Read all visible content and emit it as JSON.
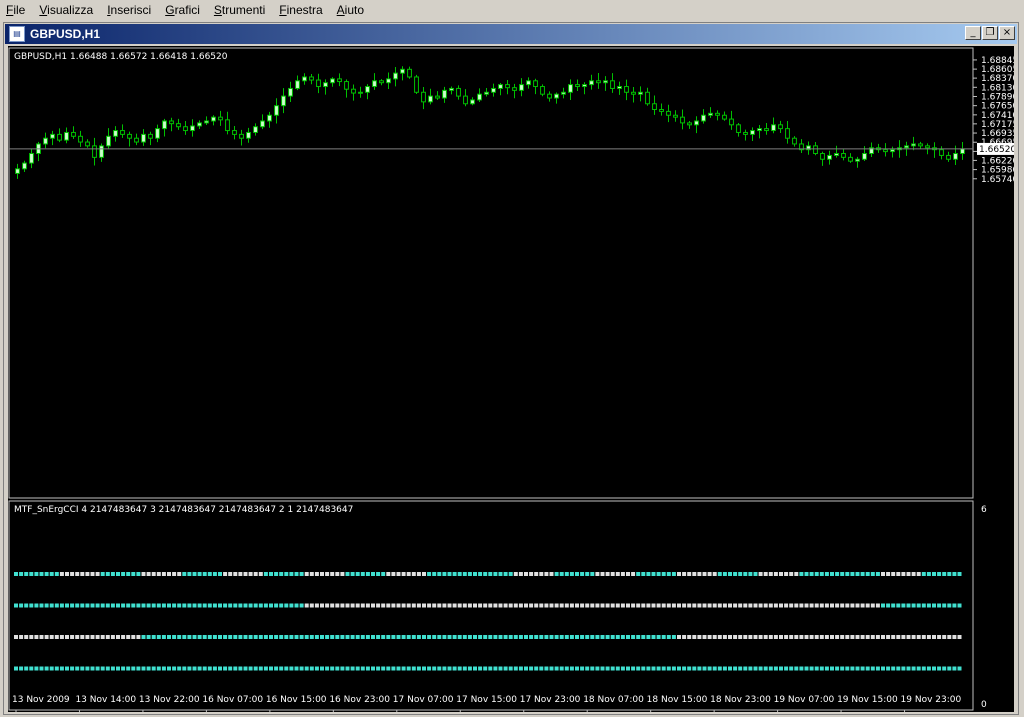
{
  "menu": [
    {
      "id": "file",
      "accel": "F",
      "rest": "ile"
    },
    {
      "id": "visualizza",
      "accel": "V",
      "rest": "isualizza"
    },
    {
      "id": "inserisci",
      "accel": "I",
      "rest": "nserisci"
    },
    {
      "id": "grafici",
      "accel": "G",
      "rest": "rafici"
    },
    {
      "id": "strumenti",
      "accel": "S",
      "rest": "trumenti"
    },
    {
      "id": "finestra",
      "accel": "F",
      "rest": "inestra"
    },
    {
      "id": "aiuto",
      "accel": "A",
      "rest": "iuto"
    }
  ],
  "window": {
    "title": "GBPUSD,H1",
    "icon": "chart-window-icon",
    "controls": [
      {
        "name": "minimize-button",
        "glyph": "_"
      },
      {
        "name": "restore-button",
        "glyph": "❐"
      },
      {
        "name": "close-button",
        "glyph": "×"
      }
    ]
  },
  "colors": {
    "bg": "#000000",
    "axis": "#c0c0c0",
    "candle_bull": "#ccffcc",
    "candle_bear": "#000000",
    "wick": "#00c000",
    "bid_line": "#808080",
    "dot_cyan": "#40e0d0",
    "dot_white": "#e0e0e0",
    "text": "#ffffff"
  },
  "chart_data": {
    "type": "candlestick",
    "symbol": "GBPUSD,H1",
    "ohlc_label": "1.66488 1.66572 1.66418 1.66520",
    "bid": "1.66520",
    "bid_value": 1.6652,
    "ylim": [
      1.574,
      1.69
    ],
    "yticks": [
      "1.68845",
      "1.68605",
      "1.68370",
      "1.68130",
      "1.67890",
      "1.67650",
      "1.67410",
      "1.67175",
      "1.66935",
      "1.66695",
      "1.66455",
      "1.66220",
      "1.65980",
      "1.65740"
    ],
    "xticks": [
      "13 Nov 2009",
      "13 Nov 14:00",
      "13 Nov 22:00",
      "16 Nov 07:00",
      "16 Nov 15:00",
      "16 Nov 23:00",
      "17 Nov 07:00",
      "17 Nov 15:00",
      "17 Nov 23:00",
      "18 Nov 07:00",
      "18 Nov 15:00",
      "18 Nov 23:00",
      "19 Nov 07:00",
      "19 Nov 15:00",
      "19 Nov 23:00"
    ],
    "closes": [
      1.66,
      1.6615,
      1.664,
      1.6665,
      1.668,
      1.669,
      1.6675,
      1.6695,
      1.6685,
      1.667,
      1.666,
      1.663,
      1.666,
      1.6685,
      1.67,
      1.669,
      1.668,
      1.667,
      1.669,
      1.668,
      1.6705,
      1.6725,
      1.6718,
      1.671,
      1.67,
      1.6712,
      1.672,
      1.6725,
      1.6735,
      1.6728,
      1.67,
      1.669,
      1.668,
      1.6695,
      1.671,
      1.6725,
      1.674,
      1.6765,
      1.679,
      1.681,
      1.683,
      1.684,
      1.6832,
      1.6815,
      1.6825,
      1.6835,
      1.6828,
      1.6808,
      1.6798,
      1.68,
      1.6815,
      1.683,
      1.6825,
      1.6835,
      1.685,
      1.686,
      1.684,
      1.68,
      1.6775,
      1.679,
      1.6785,
      1.6805,
      1.681,
      1.679,
      1.677,
      1.678,
      1.6795,
      1.68,
      1.681,
      1.682,
      1.6812,
      1.6805,
      1.682,
      1.683,
      1.6815,
      1.6795,
      1.6785,
      1.6795,
      1.68,
      1.682,
      1.6815,
      1.682,
      1.683,
      1.6825,
      1.683,
      1.681,
      1.6815,
      1.68,
      1.6795,
      1.68,
      1.677,
      1.6755,
      1.675,
      1.674,
      1.6735,
      1.672,
      1.6715,
      1.6725,
      1.674,
      1.6745,
      1.674,
      1.673,
      1.6715,
      1.6695,
      1.669,
      1.67,
      1.6705,
      1.67,
      1.6715,
      1.6705,
      1.668,
      1.6665,
      1.665,
      1.666,
      1.664,
      1.6625,
      1.6635,
      1.664,
      1.663,
      1.662,
      1.6625,
      1.664,
      1.6655,
      1.665,
      1.6645,
      1.665,
      1.6655,
      1.666,
      1.6665,
      1.666,
      1.6655,
      1.665,
      1.6635,
      1.6625,
      1.664,
      1.6652
    ],
    "indicator": {
      "label": "MTF_SnErgCCI 4 2147483647 3 2147483647 2147483647 2 1 2147483647",
      "scale_top": "6",
      "scale_bottom": "0",
      "rows": [
        {
          "level": 4,
          "pattern": "cwcwcwcwcwccwcwcwcwccwc"
        },
        {
          "level": 3,
          "pattern": "cccccccwwwwwwwwwwwwwwcc"
        },
        {
          "level": 2,
          "pattern": "wwwcccccccccccccwwwwwww"
        },
        {
          "level": 1,
          "pattern": "ccccccccccccccccccccccc"
        }
      ]
    }
  }
}
